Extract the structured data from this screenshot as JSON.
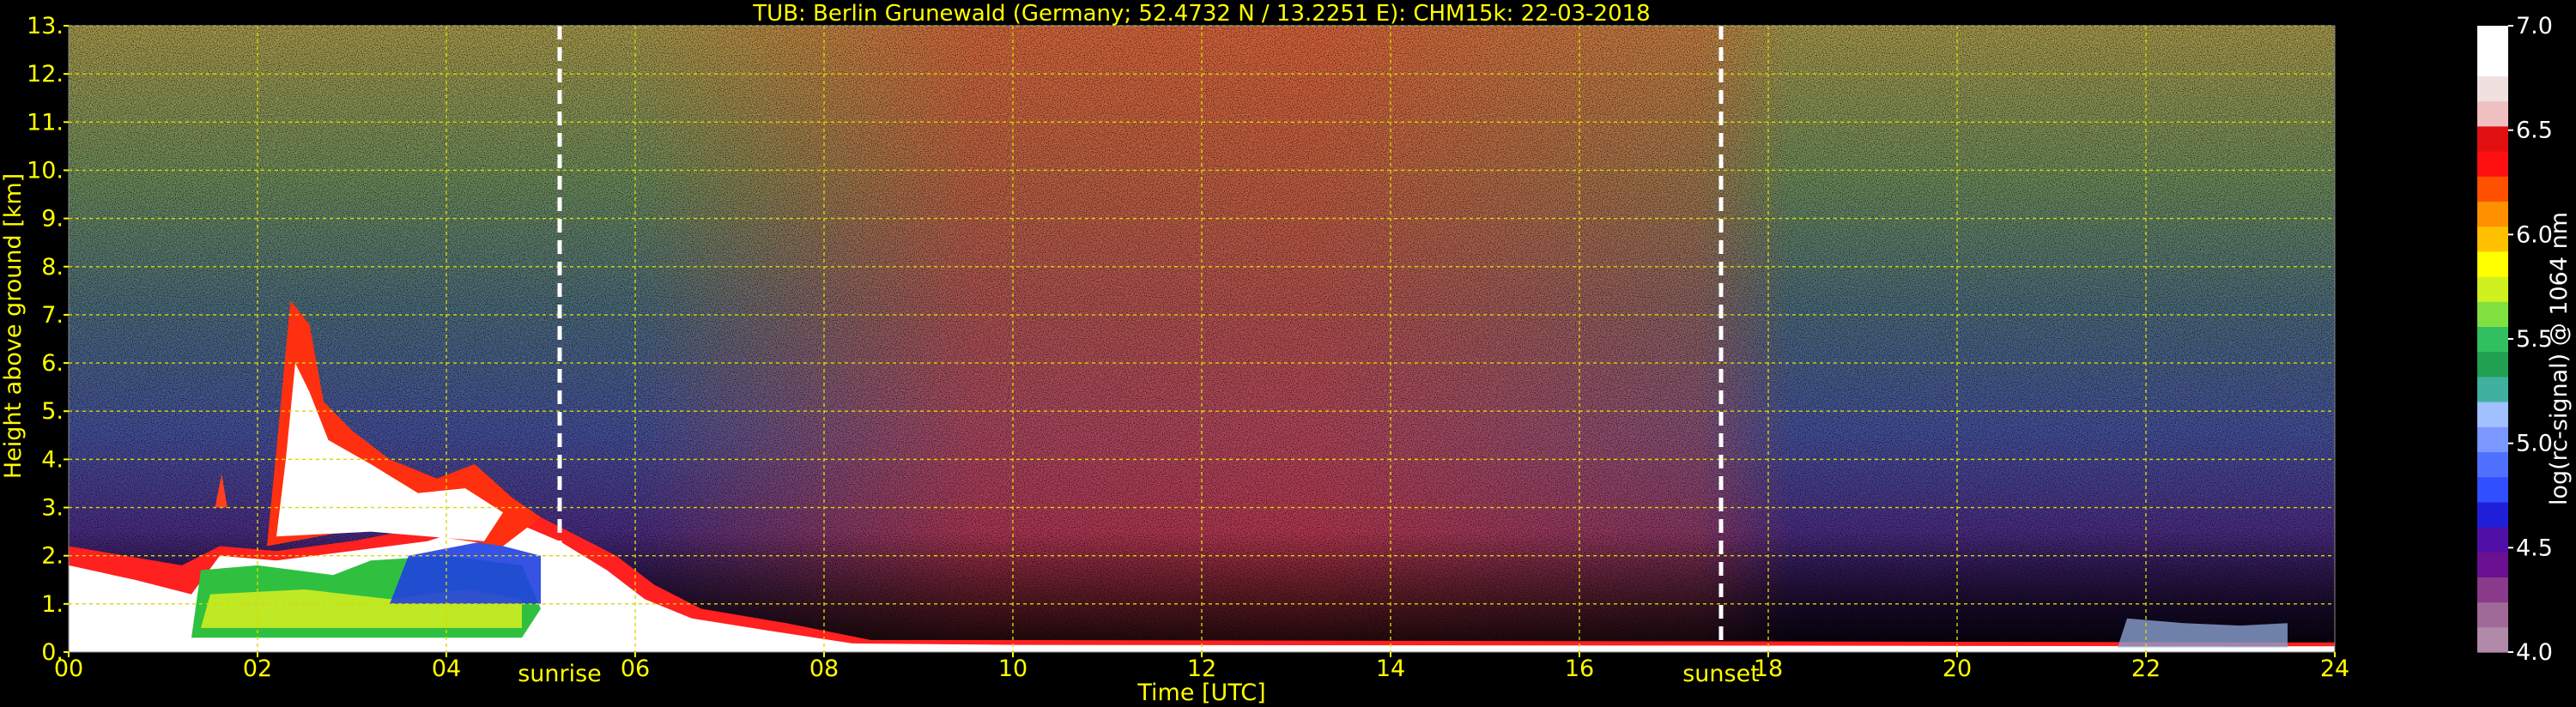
{
  "chart_data": {
    "type": "heatmap",
    "title": "TUB: Berlin Grunewald (Germany; 52.4732 N / 13.2251 E):    CHM15k: 22-03-2018",
    "xlabel": "Time [UTC]",
    "ylabel": "Height above ground [km]",
    "xlim": [
      0,
      24
    ],
    "ylim": [
      0,
      13
    ],
    "x_ticks": [
      "00",
      "02",
      "04",
      "06",
      "08",
      "10",
      "12",
      "14",
      "16",
      "18",
      "20",
      "22",
      "24"
    ],
    "y_ticks": [
      "0.",
      "1.",
      "2.",
      "3.",
      "4.",
      "5.",
      "6.",
      "7.",
      "8.",
      "9.",
      "10.",
      "11.",
      "12.",
      "13."
    ],
    "grid": true,
    "annotations": [
      {
        "label": "sunrise",
        "x": 5.2
      },
      {
        "label": "sunset",
        "x": 17.5
      }
    ],
    "colorbar": {
      "label": "log(rc-signal) @ 1064 nm",
      "range": [
        4.0,
        7.0
      ],
      "ticks": [
        "4.0",
        "4.5",
        "5.0",
        "5.5",
        "6.0",
        "6.5",
        "7.0"
      ],
      "colors": [
        "#b08aa8",
        "#a06a98",
        "#8a3a8a",
        "#6a1090",
        "#5010a8",
        "#2020d8",
        "#3050ff",
        "#5070ff",
        "#7a98ff",
        "#a0c0ff",
        "#40b0a0",
        "#20a050",
        "#30c060",
        "#80e040",
        "#d0f020",
        "#ffff00",
        "#ffc000",
        "#ff9000",
        "#ff5000",
        "#ff1010",
        "#e01010",
        "#f0c0c0",
        "#f0e0e0",
        "#ffffff",
        "#ffffff"
      ]
    },
    "features": {
      "cloud_layers": [
        {
          "t_start": 0.0,
          "t_end": 6.8,
          "h_bottom": 0.1,
          "h_top": 2.3,
          "desc": "dense low cloud/boundary layer"
        },
        {
          "t_start": 2.1,
          "t_end": 5.0,
          "h_bottom": 2.0,
          "h_top": 7.3,
          "desc": "elevated cloud"
        },
        {
          "t_start": 1.4,
          "t_end": 4.8,
          "h_bottom": 0.3,
          "h_top": 2.0,
          "desc": "green/blue layer"
        }
      ],
      "near_surface_layer": {
        "t_start": 6.8,
        "t_end": 24,
        "h_top": 0.3
      },
      "late_cloud": {
        "t_start": 21.7,
        "t_end": 23.5,
        "h_bottom": 0.1,
        "h_top": 0.7
      }
    }
  }
}
